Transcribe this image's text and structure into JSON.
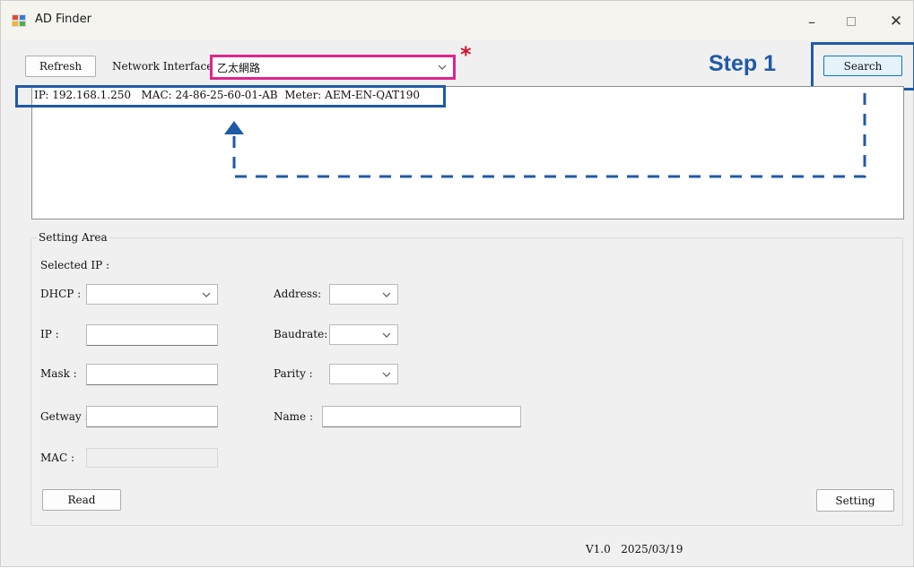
{
  "window": {
    "title": "AD Finder",
    "minimize_glyph": "–",
    "close_glyph": "✕"
  },
  "toolbar": {
    "refresh_label": "Refresh",
    "network_interface_label": "Network Interface",
    "network_interface_value": "乙太網路",
    "search_label": "Search"
  },
  "device_list": {
    "rows": [
      {
        "ip": "IP: 192.168.1.250",
        "mac": "MAC: 24-86-25-60-01-AB",
        "meter": "Meter: AEM-EN-QAT190"
      }
    ]
  },
  "setting_area": {
    "title": "Setting Area",
    "selected_ip_label": "Selected IP :",
    "dhcp_label": "DHCP :",
    "dhcp_value": "",
    "ip_label": "IP :",
    "ip_value": "",
    "mask_label": "Mask :",
    "mask_value": "",
    "gateway_label": "Getway :",
    "gateway_value": "",
    "mac_label": "MAC :",
    "mac_value": "",
    "address_label": "Address:",
    "address_value": "",
    "baudrate_label": "Baudrate:",
    "baudrate_value": "",
    "parity_label": "Parity :",
    "parity_value": "",
    "name_label": "Name :",
    "name_value": "",
    "read_label": "Read",
    "setting_label": "Setting"
  },
  "footer": {
    "version": "V1.0",
    "date": "2025/03/19"
  },
  "annotations": {
    "step_label": "Step 1",
    "asterisk": "*",
    "highlight_color": "#1f5aa6",
    "combo_highlight_color": "#e0248f",
    "asterisk_color": "#d0162d"
  }
}
